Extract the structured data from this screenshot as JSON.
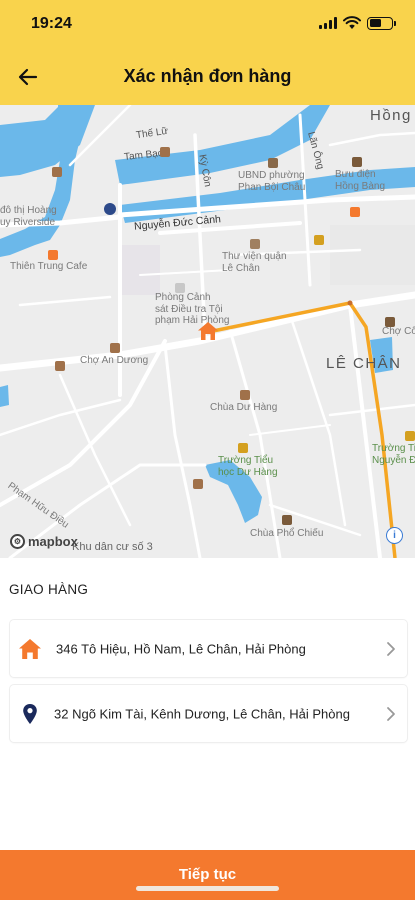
{
  "status_bar": {
    "time": "19:24"
  },
  "header": {
    "title": "Xác nhận đơn hàng"
  },
  "map": {
    "labels": {
      "thi_xa": "Hồng",
      "the_lu": "Thế Lữ",
      "tam_bac": "Tam Bạc",
      "ky_con": "Kỳ Côn",
      "lan_ong": "Lãn Ông",
      "ubnd": "UBND phường\nPhan Bội Châu",
      "buu_dien": "Bưu điện\nHồng Bàng",
      "nguyen_duc_canh": "Nguyễn Đức Cảnh",
      "do_thi": "đô thị Hoàng\nuy Riverside",
      "thien_trung": "Thiên Trung Cafe",
      "thu_vien": "Thư viện quận\nLê Chân",
      "phong_canh_sat": "Phòng Cảnh\nsát Điều tra Tội\nphạm Hải Phòng",
      "cho_cong": "Chợ Cố",
      "le_chan": "LÊ CHÂN",
      "cho_an_duong": "Chợ An Dương",
      "chua_du_hang": "Chùa Dư Hàng",
      "truong_tieu_hoc": "Trường Tiểu\nhọc Dư Hàng",
      "truong_nguyen": "Trường Tiể\nNguyễn Đ",
      "chua_pho_chieu": "Chùa Phổ Chiếu",
      "khu_dan_cu": "Khu dân cư số 3",
      "pham_huu_dieu": "Phạm Hữu Điều",
      "mapbox": "mapbox",
      "info": "i"
    },
    "route_color": "#F5A623",
    "marker_color": "#F4792E"
  },
  "delivery": {
    "section_title": "GIAO HÀNG",
    "from_address": "346 Tô Hiệu, Hồ Nam, Lê Chân, Hải Phòng",
    "to_address": "32 Ngõ Kim Tài, Kênh Dương, Lê Chân, Hải Phòng",
    "from_icon": "home-icon",
    "to_icon": "location-pin-icon",
    "from_icon_color": "#F4792E",
    "to_icon_color": "#1B2A5C"
  },
  "footer": {
    "continue_label": "Tiếp tục",
    "button_color": "#F4792E"
  }
}
